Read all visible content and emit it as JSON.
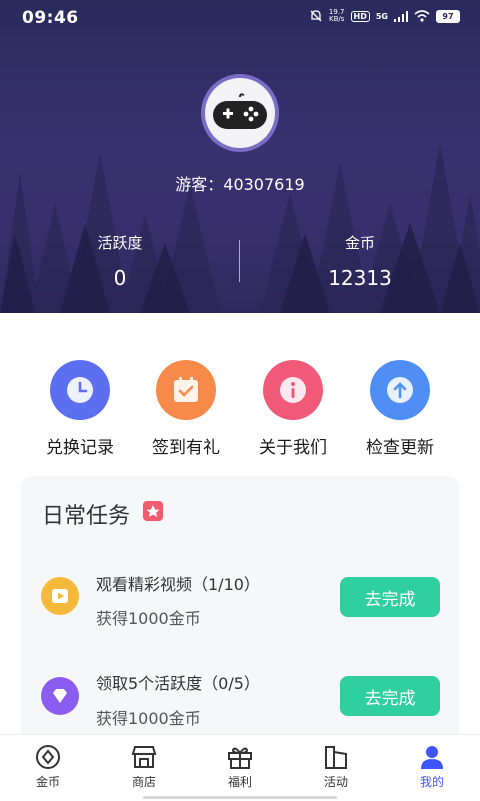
{
  "status_bar": {
    "time": "09:46",
    "net_speed_value": "19.7",
    "net_speed_unit": "KB/s",
    "hd": "HD",
    "network": "5G",
    "battery": "97"
  },
  "profile": {
    "guest_label": "游客：40307619",
    "activity_label": "活跃度",
    "activity_value": "0",
    "coins_label": "金币",
    "coins_value": "12313",
    "avatar_icon": "gamepad-icon"
  },
  "quick_actions": [
    {
      "label": "兑换记录",
      "icon": "clock-icon",
      "color": "#5b6ff0"
    },
    {
      "label": "签到有礼",
      "icon": "calendar-check-icon",
      "color": "#f7894a"
    },
    {
      "label": "关于我们",
      "icon": "info-icon",
      "color": "#f05a78"
    },
    {
      "label": "检查更新",
      "icon": "arrow-up-icon",
      "color": "#4f8ff5"
    }
  ],
  "daily_tasks": {
    "title": "日常任务",
    "items": [
      {
        "title": "观看精彩视频（1/10）",
        "reward": "获得1000金币",
        "button": "去完成",
        "icon": "play-icon",
        "color": "#f7b93b"
      },
      {
        "title": "领取5个活跃度（0/5）",
        "reward": "获得1000金币",
        "button": "去完成",
        "icon": "diamond-icon",
        "color": "#8a5cf0"
      }
    ]
  },
  "tab_bar": {
    "items": [
      {
        "label": "金币",
        "icon": "coin-icon"
      },
      {
        "label": "商店",
        "icon": "shop-icon"
      },
      {
        "label": "福利",
        "icon": "gift-icon"
      },
      {
        "label": "活动",
        "icon": "flag-icon"
      },
      {
        "label": "我的",
        "icon": "user-icon"
      }
    ],
    "active_color": "#3f55ff"
  },
  "colors": {
    "header": "#38306f",
    "button": "#2fcf9f",
    "badge": "#f25a6e"
  }
}
